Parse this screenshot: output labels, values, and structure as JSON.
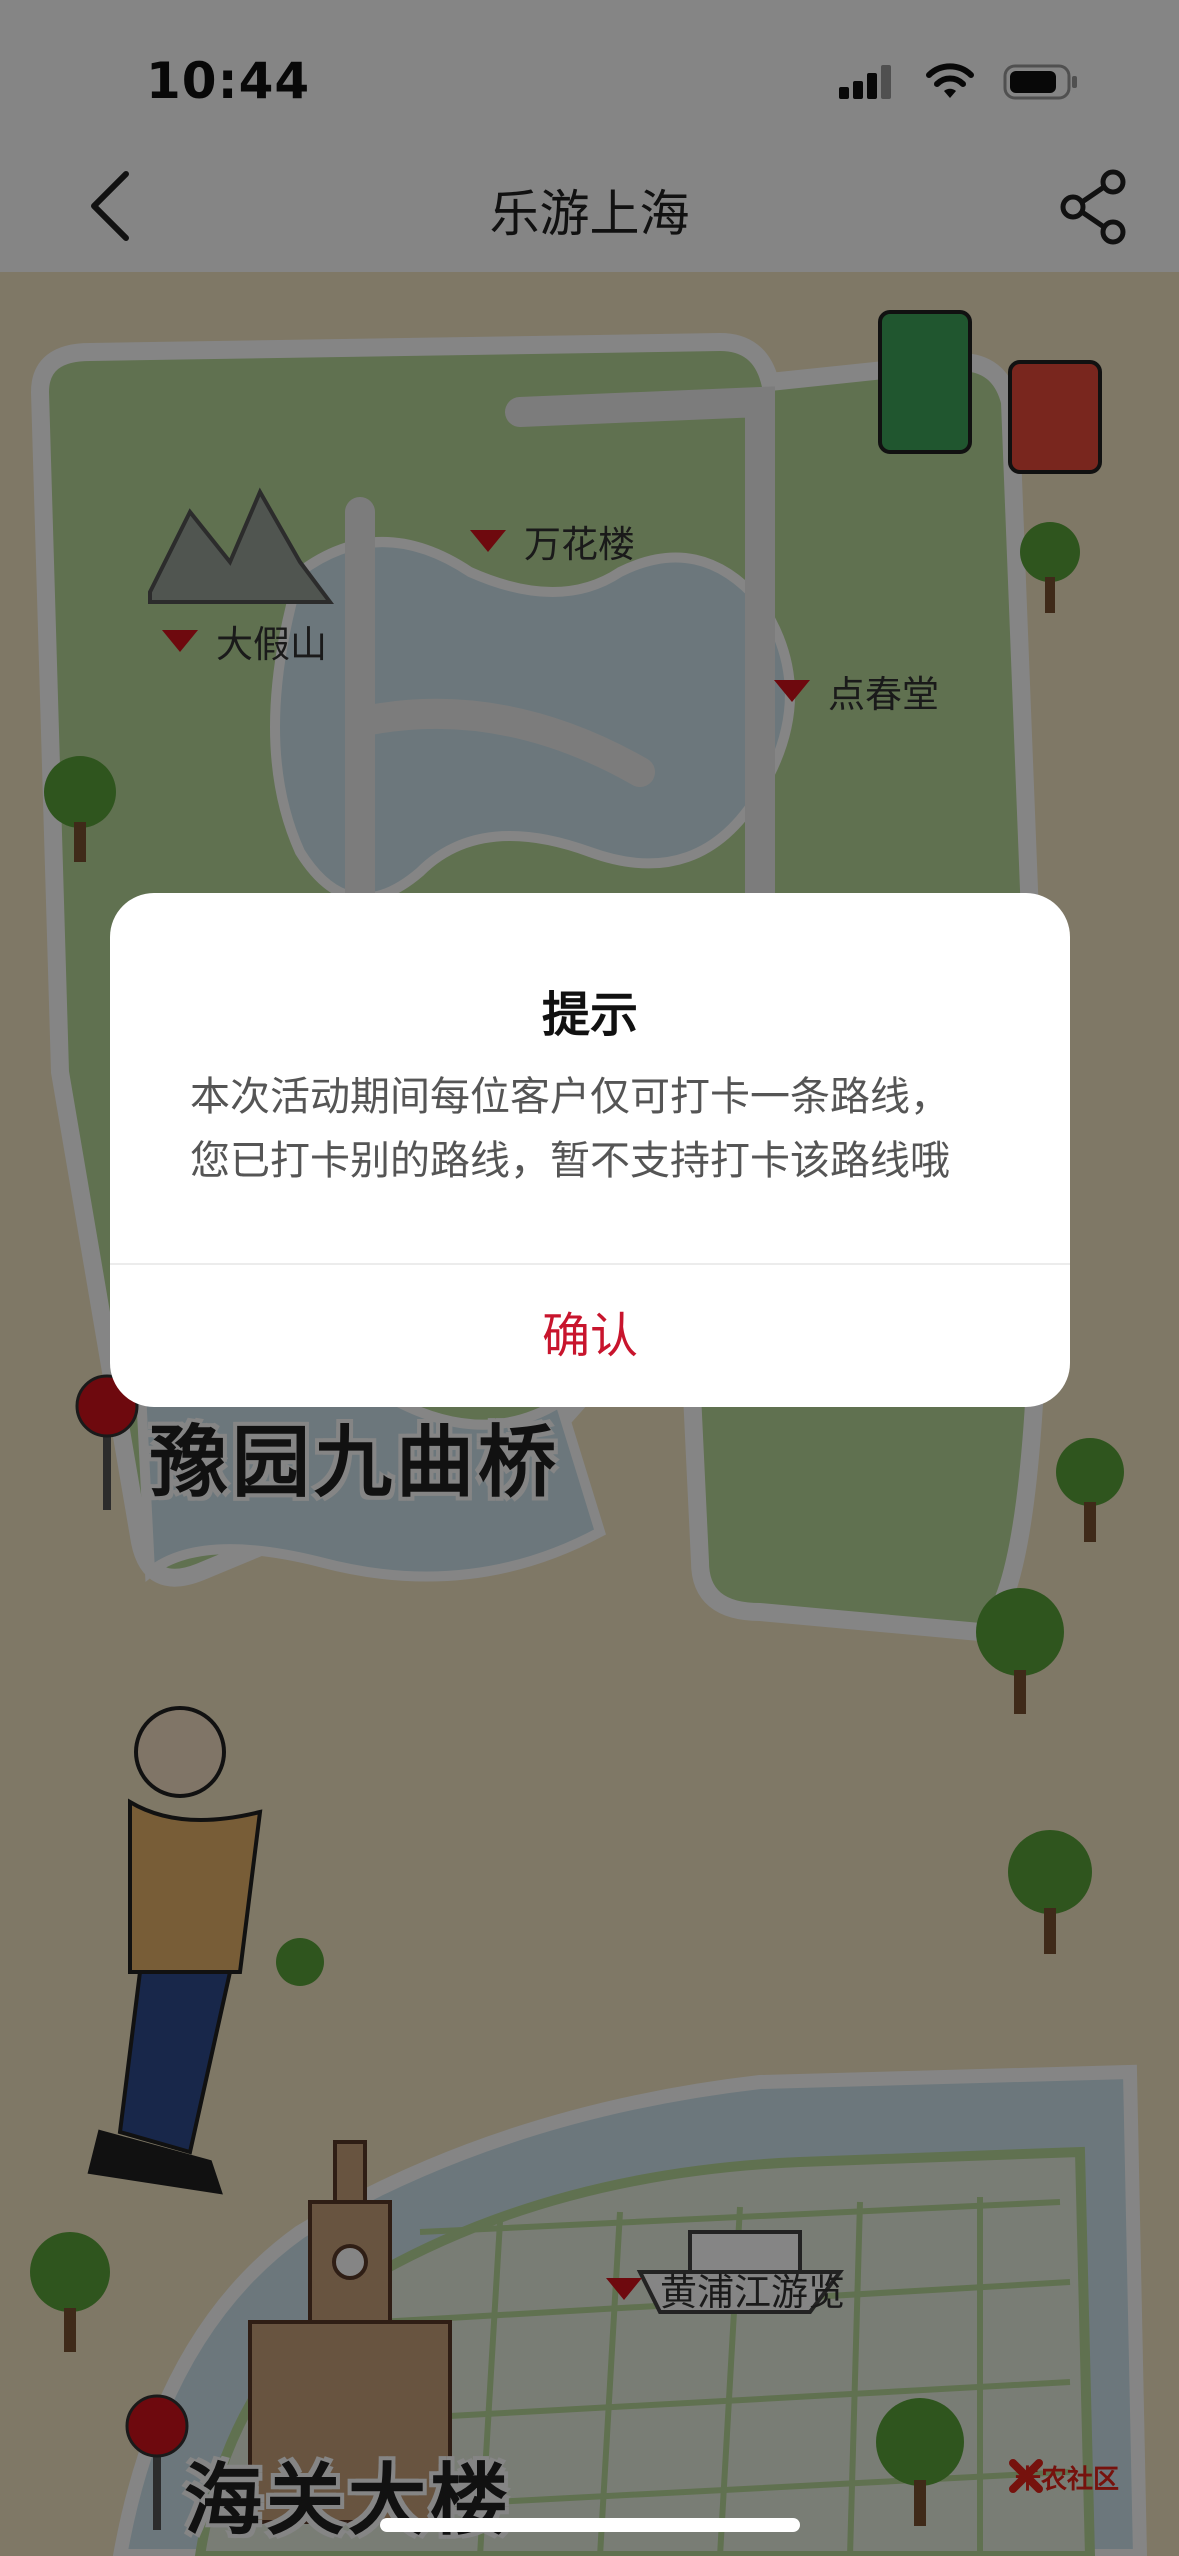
{
  "status_bar": {
    "time": "10:44"
  },
  "nav": {
    "title": "乐游上海"
  },
  "map": {
    "pois": [
      "万花楼",
      "大假山",
      "点春堂",
      "黄浦江游览"
    ],
    "landmarks": [
      "豫园九曲桥",
      "海关大楼"
    ],
    "watermark": "卡农社区"
  },
  "dialog": {
    "title": "提示",
    "message_line1": "本次活动期间每位客户仅可打卡一条路线，",
    "message_line2": "您已打卡别的路线，暂不支持打卡该路线哦",
    "confirm_label": "确认"
  },
  "icons": {
    "back": "chevron-left-icon",
    "share": "share-icon",
    "signal": "cellular-signal-icon",
    "wifi": "wifi-icon",
    "battery": "battery-icon",
    "poi_marker": "red-triangle-marker",
    "pin": "map-pin-icon"
  },
  "colors": {
    "accent": "#c8152d",
    "poi_marker": "#d3121b",
    "map_background": "#f3e6c4",
    "park_green": "#b8d89a",
    "water": "#cfe5ee",
    "overlay": "rgba(0,0,0,0.48)"
  }
}
